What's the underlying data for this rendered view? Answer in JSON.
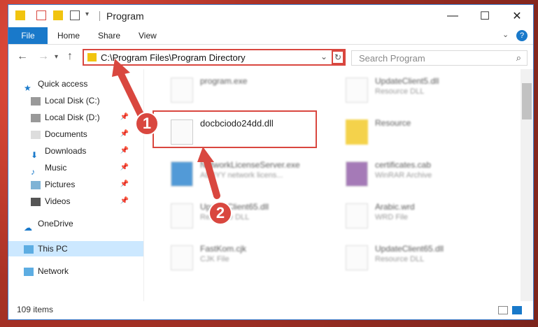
{
  "window": {
    "title": "Program"
  },
  "ribbon": {
    "tabs": [
      "File",
      "Home",
      "Share",
      "View"
    ]
  },
  "nav": {
    "address": "C:\\Program Files\\Program Directory",
    "search_placeholder": "Search Program"
  },
  "sidebar": {
    "items": [
      {
        "label": "Quick access"
      },
      {
        "label": "Local Disk (C:)"
      },
      {
        "label": "Local Disk (D:)"
      },
      {
        "label": "Documents"
      },
      {
        "label": "Downloads"
      },
      {
        "label": "Music"
      },
      {
        "label": "Pictures"
      },
      {
        "label": "Videos"
      },
      {
        "label": "OneDrive"
      },
      {
        "label": "This PC"
      },
      {
        "label": "Network"
      }
    ]
  },
  "files": [
    {
      "name": "program.exe",
      "type": ""
    },
    {
      "name": "UpdateClient5.dll",
      "type": "Resource DLL"
    },
    {
      "name": "docbciodo24dd.dll",
      "type": ""
    },
    {
      "name": "Resource",
      "type": ""
    },
    {
      "name": "NetworkLicenseServer.exe",
      "type": "ABBYY network licens..."
    },
    {
      "name": "certificates.cab",
      "type": "WinRAR Archive"
    },
    {
      "name": "UpdateClient65.dll",
      "type": "Resource DLL"
    },
    {
      "name": "Arabic.wrd",
      "type": "WRD File"
    },
    {
      "name": "FastKom.cjk",
      "type": "CJK File"
    },
    {
      "name": "UpdateClient65.dll",
      "type": "Resource DLL"
    }
  ],
  "status": {
    "items_count": "109 items"
  },
  "annotations": {
    "step1": "1",
    "step2": "2"
  },
  "colors": {
    "accent": "#1979ca",
    "highlight": "#d9473f"
  }
}
